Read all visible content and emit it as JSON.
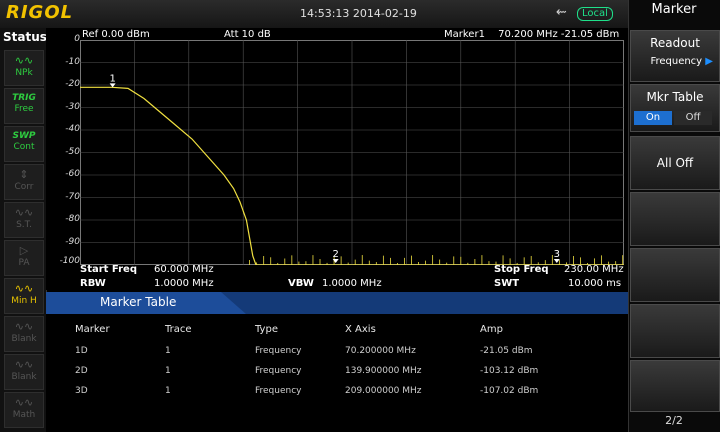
{
  "brand": "RIGOL",
  "datetime": "14:53:13 2014-02-19",
  "remote_status": "Local",
  "status_panel": {
    "title": "Status",
    "buttons": [
      {
        "icon": "waveform-icon",
        "label": "NPk",
        "color": "#2ecc40"
      },
      {
        "label1": "TRIG",
        "label2": "Free",
        "color": "#2ecc40"
      },
      {
        "label1": "SWP",
        "label2": "Cont",
        "color": "#2ecc40"
      },
      {
        "icon": "arrows-icon",
        "label": "Corr",
        "color": "#555555"
      },
      {
        "icon": "waveform-icon",
        "label": "S.T.",
        "color": "#555555"
      },
      {
        "icon": "preamp-icon",
        "label": "PA",
        "color": "#555555"
      },
      {
        "icon": "waveform-icon",
        "label": "Min H",
        "color": "#e6c200"
      },
      {
        "icon": "waveform-icon",
        "label": "Blank",
        "color": "#555555"
      },
      {
        "icon": "waveform-icon",
        "label": "Blank",
        "color": "#555555"
      },
      {
        "icon": "waveform-icon",
        "label": "Math",
        "color": "#555555"
      }
    ]
  },
  "header": {
    "ref": "Ref 0.00 dBm",
    "att": "Att 10 dB",
    "marker_label": "Marker1",
    "marker_readout": "70.200 MHz -21.05 dBm"
  },
  "yaxis_labels": [
    "0",
    "-10",
    "-20",
    "-30",
    "-40",
    "-50",
    "-60",
    "-70",
    "-80",
    "-90",
    "-100"
  ],
  "sweep_info": {
    "start_freq_label": "Start Freq",
    "start_freq_value": "60.000 MHz",
    "stop_freq_label": "Stop Freq",
    "stop_freq_value": "230.00 MHz",
    "rbw_label": "RBW",
    "rbw_value": "1.0000 MHz",
    "vbw_label": "VBW",
    "vbw_value": "1.0000 MHz",
    "swt_label": "SWT",
    "swt_value": "10.000 ms"
  },
  "marker_table": {
    "title": "Marker Table",
    "headers": [
      "Marker",
      "Trace",
      "Type",
      "X Axis",
      "Amp"
    ],
    "rows": [
      [
        "1D",
        "1",
        "Frequency",
        "70.200000 MHz",
        "-21.05 dBm"
      ],
      [
        "2D",
        "1",
        "Frequency",
        "139.900000 MHz",
        "-103.12 dBm"
      ],
      [
        "3D",
        "1",
        "Frequency",
        "209.000000 MHz",
        "-107.02 dBm"
      ]
    ]
  },
  "menu": {
    "title": "Marker",
    "readout_label": "Readout",
    "readout_value": "Frequency",
    "mkr_table_label": "Mkr Table",
    "mkr_table_on": "On",
    "mkr_table_off": "Off",
    "all_off": "All Off",
    "page": "2/2"
  },
  "chart_data": {
    "type": "line",
    "title": "",
    "xlabel": "",
    "ylabel": "",
    "xlim": [
      60,
      230
    ],
    "ylim": [
      -100,
      0
    ],
    "grid": true,
    "series": [
      {
        "color": "#f0e040",
        "x": [
          60,
          70,
          75,
          80,
          85,
          90,
          95,
          100,
          105,
          108,
          110,
          112,
          113,
          114,
          115,
          118,
          120,
          125,
          130,
          140,
          150,
          160,
          170,
          180,
          190,
          200,
          209,
          220,
          230
        ],
        "y": [
          -21,
          -21,
          -21.5,
          -26,
          -32,
          -38,
          -44,
          -52,
          -60,
          -66,
          -72,
          -80,
          -88,
          -96,
          -100,
          -100,
          -100,
          -100,
          -100,
          -100,
          -100,
          -100,
          -100,
          -100,
          -100,
          -100,
          -100,
          -100,
          -100
        ]
      }
    ],
    "markers": [
      {
        "label": "1",
        "x": 70.2,
        "y": -21.05
      },
      {
        "label": "2",
        "x": 139.9,
        "y": -103.12
      },
      {
        "label": "3",
        "x": 209.0,
        "y": -107.02
      }
    ]
  }
}
